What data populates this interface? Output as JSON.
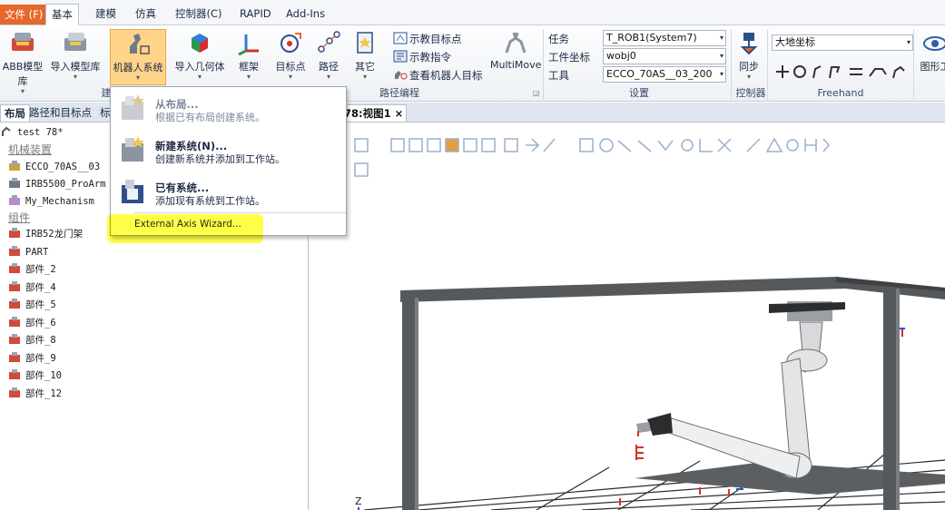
{
  "tabs": {
    "file": "文件 (F)",
    "basic": "基本",
    "modeling": "建模",
    "simulation": "仿真",
    "controller": "控制器(C)",
    "rapid": "RAPID",
    "addins": "Add-Ins"
  },
  "ribbon": {
    "abb_library": "ABB模型库",
    "import_library": "导入模型库",
    "robot_system": "机器人系统",
    "import_geometry": "导入几何体",
    "frame": "框架",
    "target": "目标点",
    "path": "路径",
    "other": "其它",
    "teach_target": "示教目标点",
    "teach_instruction": "示教指令",
    "view_robot_target": "查看机器人目标",
    "multimove": "MultiMove",
    "task_label": "任务",
    "task_value": "T_ROB1(System7)",
    "wobj_label": "工件坐标",
    "wobj_value": "wobj0",
    "tool_label": "工具",
    "tool_value": "ECCO_70AS__03_200",
    "sync": "同步",
    "coord_value": "大地坐标",
    "graphics": "图形工",
    "group_build": "建",
    "group_path": "路径编程",
    "group_settings": "设置",
    "group_controller": "控制器",
    "group_freehand": "Freehand"
  },
  "left_panel": {
    "tabs": [
      "布局",
      "路径和目标点",
      "标"
    ],
    "station": "test 78*",
    "mechanisms_header": "机械装置",
    "mechanisms": [
      "ECCO_70AS__03",
      "IRB5500_ProArm",
      "My_Mechanism"
    ],
    "components_header": "组件",
    "components": [
      "IRB52龙门架",
      "PART",
      "部件_2",
      "部件_4",
      "部件_5",
      "部件_6",
      "部件_8",
      "部件_9",
      "部件_10",
      "部件_12"
    ]
  },
  "viewport": {
    "tab_title": "78:视图1",
    "close": "×",
    "axis_z": "Z"
  },
  "menu": {
    "from_layout_title": "从布局...",
    "from_layout_desc": "根据已有布局创建系统。",
    "new_system_title": "新建系统(N)...",
    "new_system_desc": "创建新系统并添加到工作站。",
    "existing_system_title": "已有系统...",
    "existing_system_desc": "添加现有系统到工作站。",
    "external_axis_wizard": "External Axis Wizard..."
  },
  "colors": {
    "file_tab": "#e6672b",
    "pressed_button": "#ffd48a",
    "highlight": "#ffff28",
    "frame_steel": "#55595c"
  }
}
